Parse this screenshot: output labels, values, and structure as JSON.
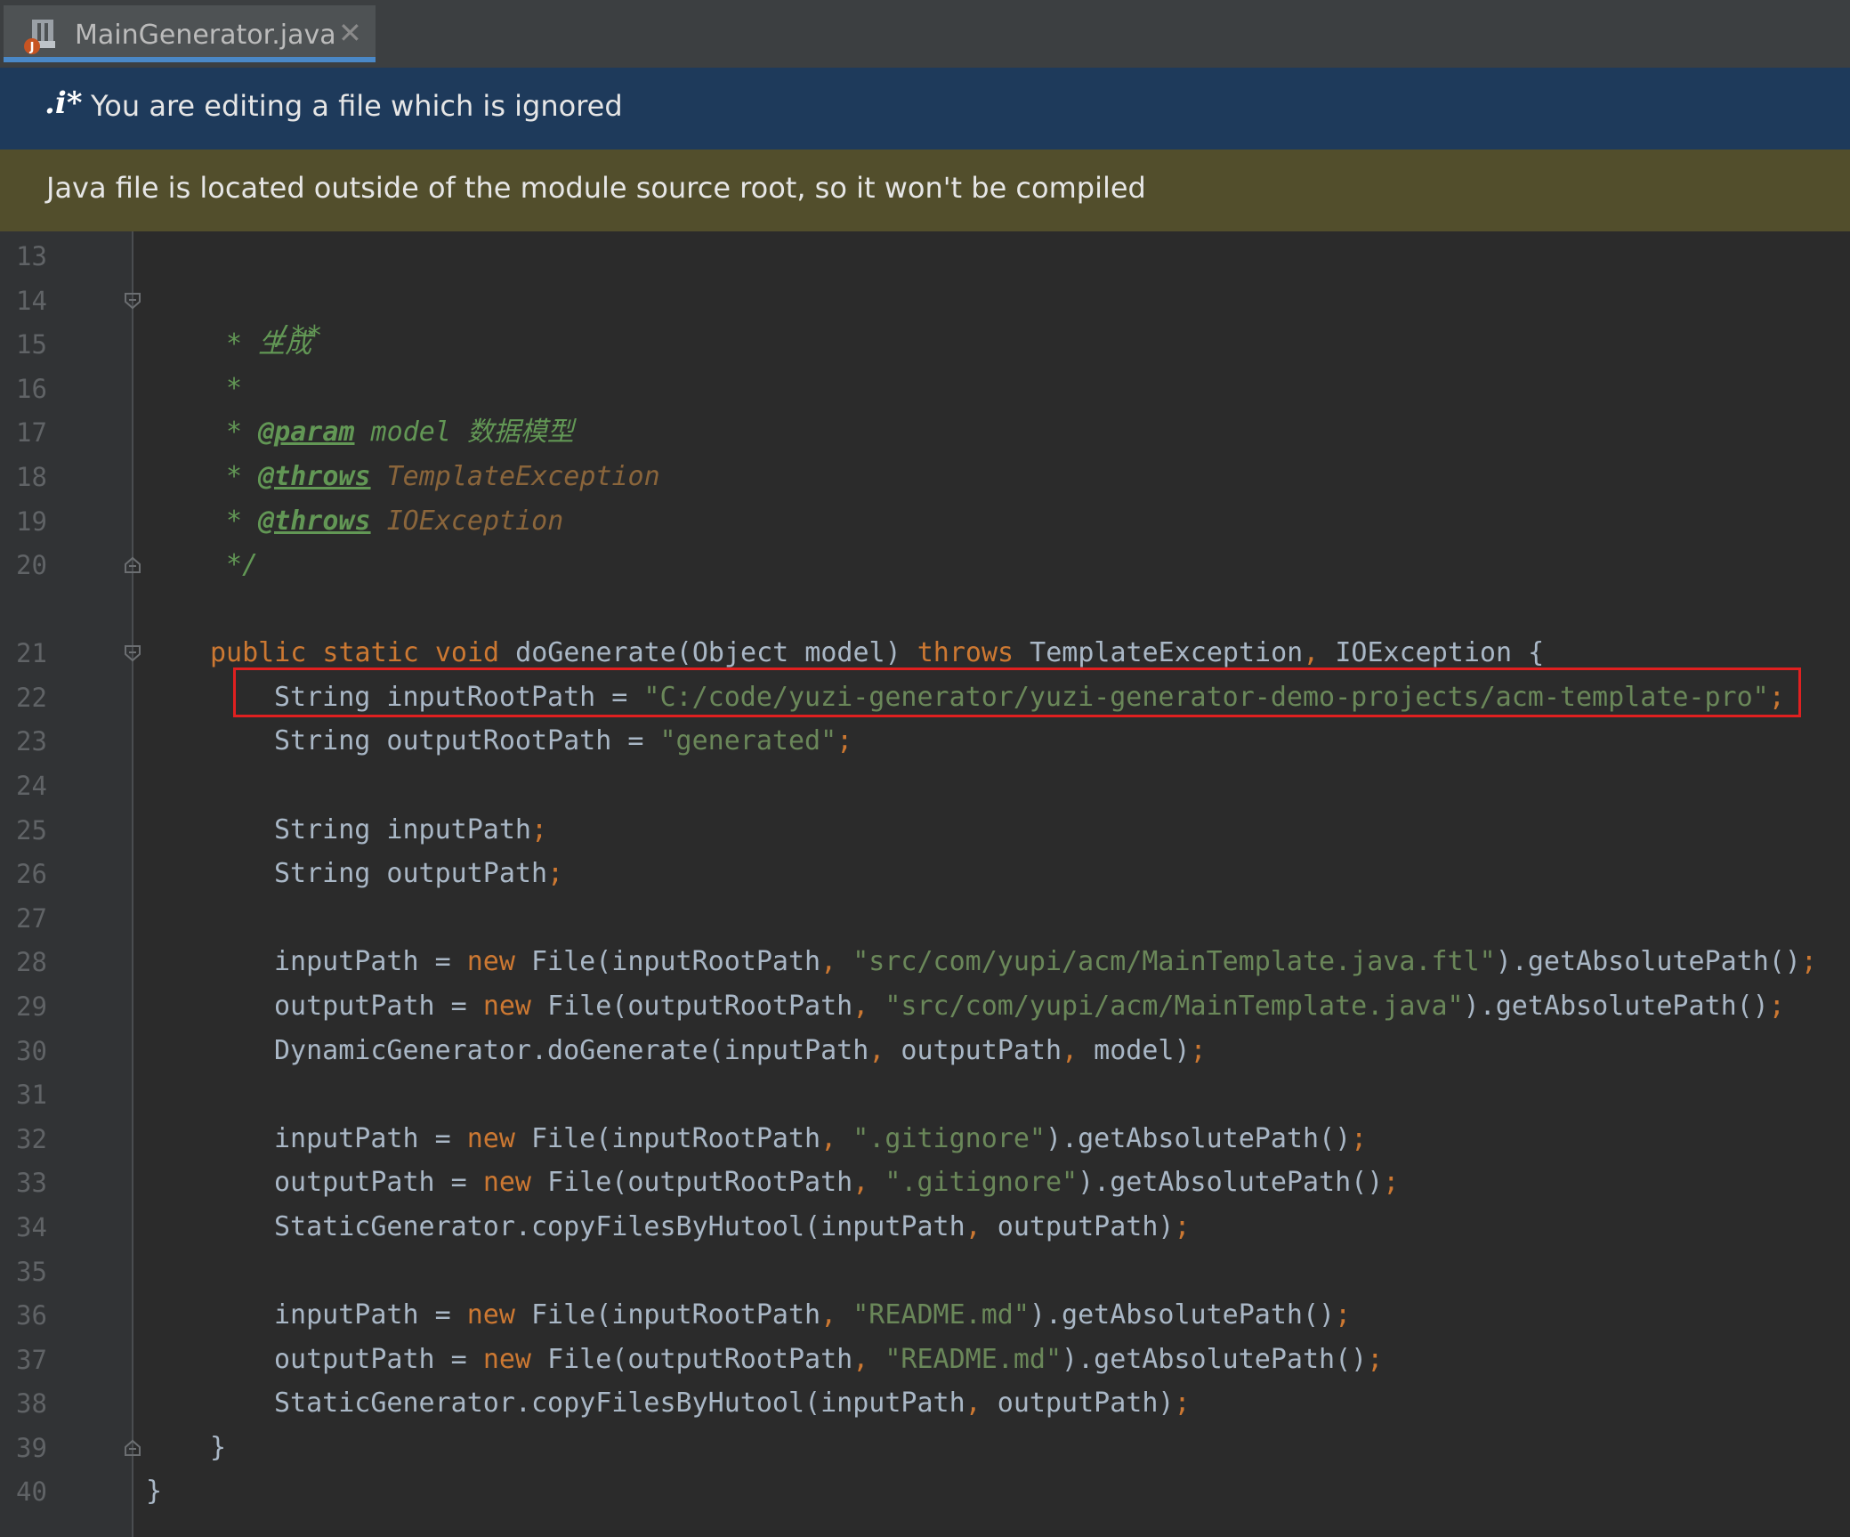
{
  "tab": {
    "title": "MainGenerator.java",
    "close_glyph": "✕"
  },
  "banner_info": {
    "icon_text": ".i*",
    "text": "You are editing a file which is ignored"
  },
  "banner_warn": {
    "text": "Java file is located outside of the module source root, so it won't be compiled"
  },
  "editor": {
    "line_numbers": [
      "13",
      "14",
      "15",
      "16",
      "17",
      "18",
      "19",
      "20",
      "21",
      "22",
      "23",
      "24",
      "25",
      "26",
      "27",
      "28",
      "29",
      "30",
      "31",
      "32",
      "33",
      "34",
      "35",
      "36",
      "37",
      "38",
      "39",
      "40"
    ],
    "lines": {
      "l14": "/**",
      "l15_star": "* ",
      "l15_text": "生成",
      "l16": "*",
      "l17_star": "* ",
      "l17_tag": "@param",
      "l17_arg": " model ",
      "l17_text": "数据模型",
      "l18_star": "* ",
      "l18_tag": "@throws",
      "l18_arg": " TemplateException",
      "l19_star": "* ",
      "l19_tag": "@throws",
      "l19_arg": " IOException",
      "l20": "*/",
      "l21_kw": "public static void ",
      "l21_mid": "doGenerate(Object model) ",
      "l21_throws": "throws ",
      "l21_ex1": "TemplateException",
      "l21_comma": ", ",
      "l21_ex2": "IOException {",
      "l22_a": "String inputRootPath = ",
      "l22_str": "\"C:/code/yuzi-generator/yuzi-generator-demo-projects/acm-template-pro\"",
      "l22_semi": ";",
      "l23_a": "String outputRootPath = ",
      "l23_str": "\"generated\"",
      "l23_semi": ";",
      "l25_a": "String inputPath",
      "l25_semi": ";",
      "l26_a": "String outputPath",
      "l26_semi": ";",
      "l28_a": "inputPath = ",
      "l28_new": "new ",
      "l28_b": "File(inputRootPath",
      "l28_c": ", ",
      "l28_str": "\"src/com/yupi/acm/MainTemplate.java.ftl\"",
      "l28_d": ").getAbsolutePath()",
      "l28_semi": ";",
      "l29_a": "outputPath = ",
      "l29_new": "new ",
      "l29_b": "File(outputRootPath",
      "l29_c": ", ",
      "l29_str": "\"src/com/yupi/acm/MainTemplate.java\"",
      "l29_d": ").getAbsolutePath()",
      "l29_semi": ";",
      "l30_a": "DynamicGenerator.doGenerate(inputPath",
      "l30_c1": ", ",
      "l30_b": "outputPath",
      "l30_c2": ", ",
      "l30_d": "model)",
      "l30_semi": ";",
      "l32_a": "inputPath = ",
      "l32_new": "new ",
      "l32_b": "File(inputRootPath",
      "l32_c": ", ",
      "l32_str": "\".gitignore\"",
      "l32_d": ").getAbsolutePath()",
      "l32_semi": ";",
      "l33_a": "outputPath = ",
      "l33_new": "new ",
      "l33_b": "File(outputRootPath",
      "l33_c": ", ",
      "l33_str": "\".gitignore\"",
      "l33_d": ").getAbsolutePath()",
      "l33_semi": ";",
      "l34_a": "StaticGenerator.copyFilesByHutool(inputPath",
      "l34_c": ", ",
      "l34_b": "outputPath)",
      "l34_semi": ";",
      "l36_a": "inputPath = ",
      "l36_new": "new ",
      "l36_b": "File(inputRootPath",
      "l36_c": ", ",
      "l36_str": "\"README.md\"",
      "l36_d": ").getAbsolutePath()",
      "l36_semi": ";",
      "l37_a": "outputPath = ",
      "l37_new": "new ",
      "l37_b": "File(outputRootPath",
      "l37_c": ", ",
      "l37_str": "\"README.md\"",
      "l37_d": ").getAbsolutePath()",
      "l37_semi": ";",
      "l38_a": "StaticGenerator.copyFilesByHutool(inputPath",
      "l38_c": ", ",
      "l38_b": "outputPath)",
      "l38_semi": ";",
      "l39": "}",
      "l40": "}"
    }
  },
  "colors": {
    "editor_bg": "#2b2b2b",
    "gutter_bg": "#313335",
    "info_banner": "#1e3a5b",
    "warn_banner": "#524e2c",
    "keyword": "#cc7832",
    "string": "#6a8759",
    "doc_comment": "#629755",
    "identifier": "#a9b7c6",
    "highlight_border": "#e02020",
    "tab_underline": "#4a88c7"
  }
}
